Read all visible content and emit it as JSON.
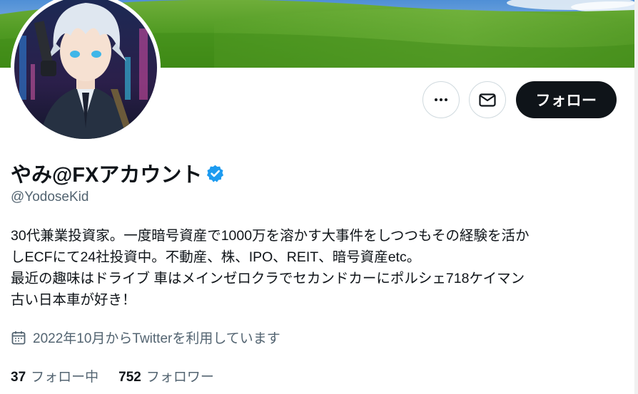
{
  "profile": {
    "display_name": "やみ@FXアカウント",
    "handle": "@YodoseKid",
    "verified_icon": "verified-badge-icon",
    "bio_lines": [
      "30代兼業投資家。一度暗号資産で1000万を溶かす大事件をしつつもその経験を活か",
      "しECFにて24社投資中。不動産、株、IPO、REIT、暗号資産etc。",
      "最近の趣味はドライブ 車はメインゼロクラでセカンドカーにポルシェ718ケイマン",
      "古い日本車が好き！"
    ],
    "joined": "2022年10月からTwitterを利用しています",
    "following_count": "37",
    "following_label": "フォロー中",
    "followers_count": "752",
    "followers_label": "フォロワー"
  },
  "actions": {
    "more_icon": "more-dots-icon",
    "message_icon": "envelope-icon",
    "follow_label": "フォロー"
  },
  "colors": {
    "primary_text": "#0f1419",
    "secondary_text": "#536471",
    "verified_blue": "#1d9bf0",
    "border": "#cfd9de"
  }
}
